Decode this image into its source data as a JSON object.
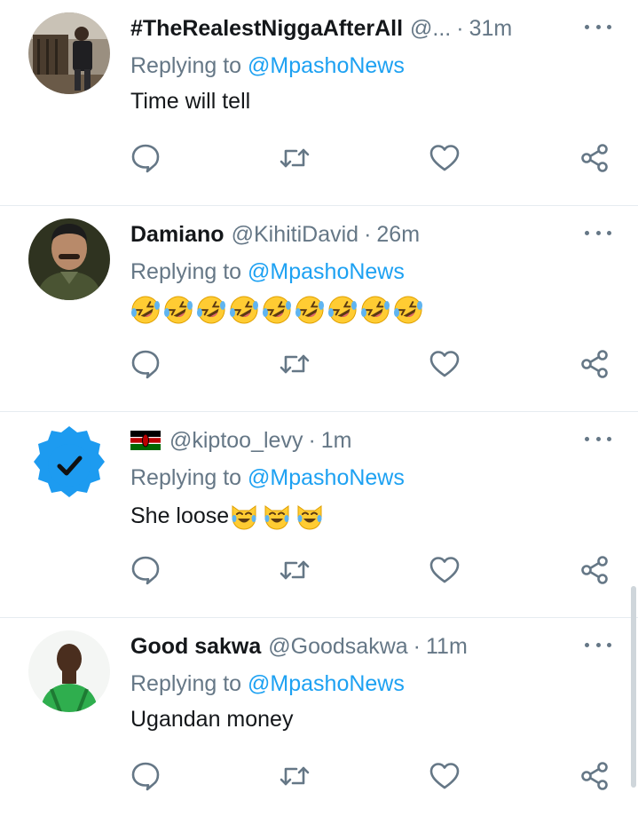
{
  "tweets": [
    {
      "name": "#TheRealestNiggaAfterAll",
      "handle": "@...",
      "time": "31m",
      "replying_prefix": "Replying to ",
      "replying_to": "@MpashoNews",
      "text": "Time will tell",
      "avatar_icon": "person-photo-avatar"
    },
    {
      "name": "Damiano",
      "handle": "@KihitiDavid",
      "time": "26m",
      "replying_prefix": "Replying to ",
      "replying_to": "@MpashoNews",
      "text": "",
      "emoji_count": 9,
      "emoji_icon": "rolling-on-floor-laughing-emoji",
      "avatar_icon": "man-in-uniform-avatar"
    },
    {
      "name": "",
      "handle": "@kiptoo_levy",
      "time": "1m",
      "replying_prefix": "Replying to ",
      "replying_to": "@MpashoNews",
      "text": "She loose",
      "emoji_count": 3,
      "emoji_icon": "cat-tears-of-joy-emoji",
      "name_icon": "kenya-flag-icon",
      "avatar_icon": "verified-checkmark-avatar"
    },
    {
      "name": "Good sakwa",
      "handle": "@Goodsakwa",
      "time": "11m",
      "replying_prefix": "Replying to ",
      "replying_to": "@MpashoNews",
      "text": "Ugandan money",
      "avatar_icon": "man-green-shirt-avatar"
    }
  ],
  "actions": [
    "reply-icon",
    "retweet-icon",
    "like-icon",
    "share-icon"
  ],
  "separator": "·",
  "colors": {
    "text": "#14171a",
    "muted": "#657786",
    "link": "#1da1f2",
    "divider": "#e6ecf0"
  }
}
